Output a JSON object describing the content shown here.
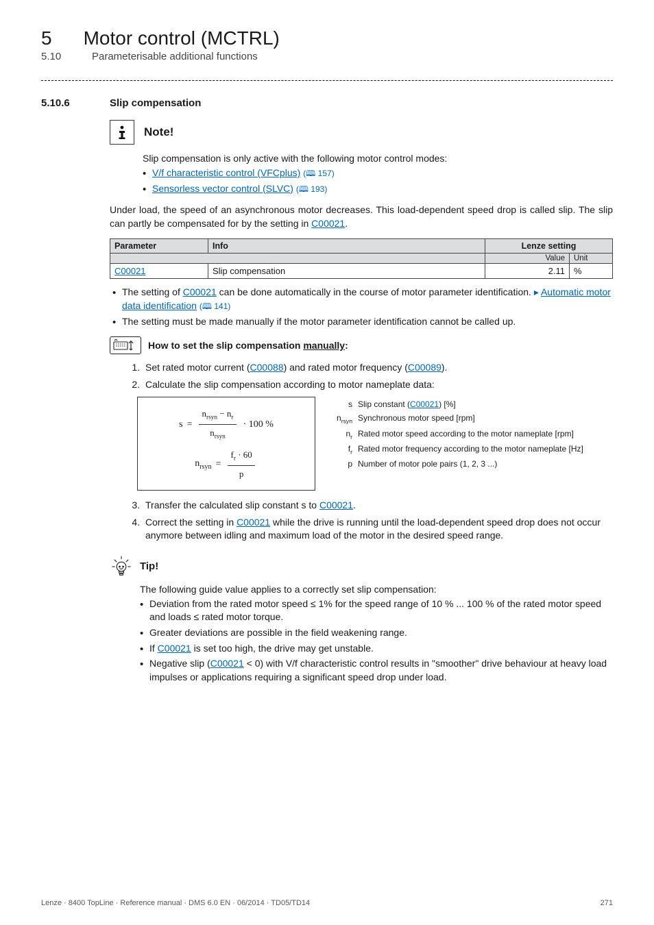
{
  "header": {
    "chapter_num": "5",
    "chapter_title": "Motor control (MCTRL)",
    "sub_num": "5.10",
    "sub_title": "Parameterisable additional functions"
  },
  "section": {
    "num": "5.10.6",
    "title": "Slip compensation"
  },
  "note": {
    "label": "Note!",
    "intro": "Slip compensation is only active with the following motor control modes:",
    "items": [
      {
        "text": "V/f characteristic control (VFCplus)",
        "page": "157"
      },
      {
        "text": "Sensorless vector control (SLVC)",
        "page": "193"
      }
    ]
  },
  "body1_a": "Under load, the speed of an asynchronous motor decreases. This load-dependent speed drop is called slip. The slip can partly be compensated for by the setting in ",
  "body1_link": "C00021",
  "body1_b": ".",
  "table": {
    "head_param": "Parameter",
    "head_info": "Info",
    "head_lenze": "Lenze setting",
    "sub_value": "Value",
    "sub_unit": "Unit",
    "row": {
      "param": "C00021",
      "info": "Slip compensation",
      "value": "2.11",
      "unit": "%"
    }
  },
  "post_table": [
    {
      "a": "The setting of ",
      "link1": "C00021",
      "b": " can be done automatically in the course of motor parameter identification. ",
      "link2": "Automatic motor data identification",
      "page": "141"
    },
    {
      "plain": "The setting must be made manually if the motor parameter identification cannot be called up."
    }
  ],
  "howto": {
    "title_a": "How to set the slip compensation ",
    "title_u": "manually",
    "title_b": ":"
  },
  "steps12": [
    {
      "a": "Set rated motor current (",
      "link1": "C00088",
      "b": ") and rated motor frequency (",
      "link2": "C00089",
      "c": ")."
    },
    {
      "plain": "Calculate the slip compensation according to motor nameplate data:"
    }
  ],
  "formula": {
    "line1": {
      "lhs": "s",
      "eq": "=",
      "num": "n<sub>rsyn</sub> − n<sub>r</sub>",
      "den": "n<sub>rsyn</sub>",
      "mult": "· 100 %"
    },
    "line2": {
      "lhs": "n<sub>rsyn</sub>",
      "eq": "=",
      "num": "f<sub>r</sub> · 60",
      "den": "p"
    }
  },
  "legend": [
    {
      "sym": "s",
      "a": "Slip constant (",
      "link": "C00021",
      "b": ") [%]"
    },
    {
      "sym": "n<sub>rsyn</sub>",
      "plain": "Synchronous motor speed [rpm]"
    },
    {
      "sym": "n<sub>r</sub>",
      "plain": "Rated motor speed according to the motor nameplate [rpm]"
    },
    {
      "sym": "f<sub>r</sub>",
      "plain": "Rated motor frequency according to the motor nameplate [Hz]"
    },
    {
      "sym": "p",
      "plain": "Number of motor pole pairs (1, 2, 3 ...)"
    }
  ],
  "steps34": [
    {
      "a": "Transfer the calculated slip constant s to ",
      "link": "C00021",
      "b": "."
    },
    {
      "a": "Correct the setting in ",
      "link": "C00021",
      "b": " while the drive is running until the load-dependent speed drop does not occur anymore between idling and maximum load of the motor in the desired speed range."
    }
  ],
  "tip": {
    "label": "Tip!",
    "intro": "The following guide value applies to a correctly set slip compensation:",
    "items": [
      {
        "plain": "Deviation from the rated motor speed ≤ 1% for the speed range of 10 % ... 100 % of the rated motor speed and loads ≤ rated motor torque."
      },
      {
        "plain": "Greater deviations are possible in the field weakening range."
      },
      {
        "a": "If ",
        "link": "C00021",
        "b": " is set too high, the drive may get unstable."
      },
      {
        "a": "Negative slip (",
        "link": "C00021",
        "b": " < 0) with V/f characteristic control results in \"smoother\" drive behaviour at heavy load impulses or applications requiring a significant speed drop under load."
      }
    ]
  },
  "footer": {
    "left": "Lenze · 8400 TopLine · Reference manual · DMS 6.0 EN · 06/2014 · TD05/TD14",
    "right": "271"
  }
}
